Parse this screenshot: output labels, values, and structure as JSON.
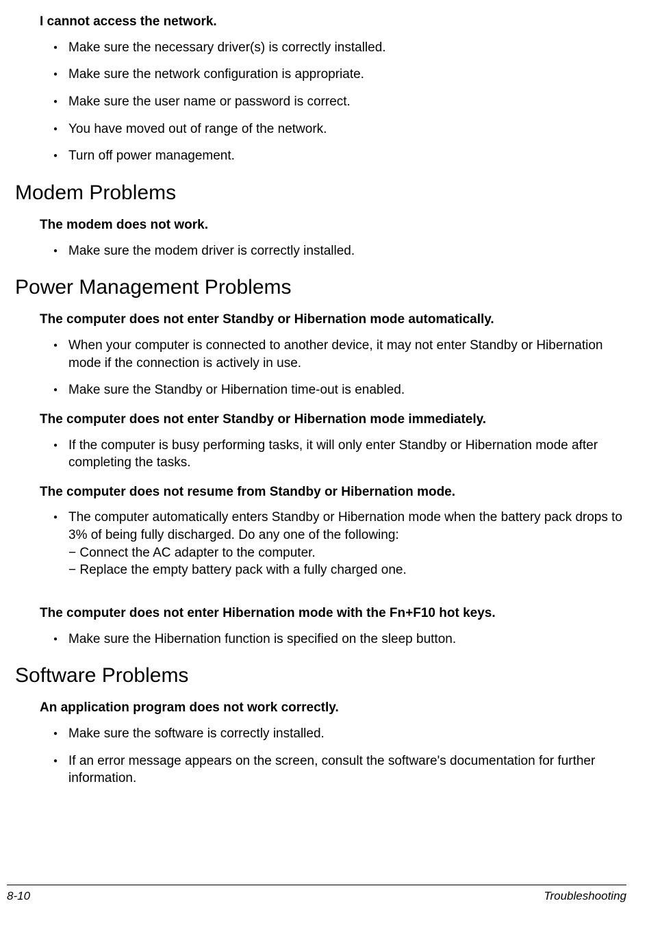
{
  "intro": {
    "title": "I cannot access the network.",
    "items": [
      "Make sure the necessary driver(s) is correctly installed.",
      "Make sure the network configuration is appropriate.",
      "Make sure the user name or password is correct.",
      "You have moved out of range of the network.",
      "Turn off power management."
    ]
  },
  "sections": [
    {
      "heading": "Modem Problems",
      "problems": [
        {
          "title": "The modem does not work.",
          "items": [
            {
              "text": "Make sure the modem driver is correctly installed."
            }
          ]
        }
      ]
    },
    {
      "heading": "Power Management Problems",
      "problems": [
        {
          "title": "The computer does not enter Standby or Hibernation mode automatically.",
          "items": [
            {
              "text": "When your computer is connected to another device, it may not enter Standby or Hibernation mode if the connection is actively in use."
            },
            {
              "text": "Make sure the Standby or Hibernation time-out is enabled."
            }
          ]
        },
        {
          "title": "The computer does not enter Standby or Hibernation mode immediately.",
          "items": [
            {
              "text": "If the computer is busy performing tasks, it will only enter Standby or Hibernation mode after completing the tasks."
            }
          ]
        },
        {
          "title": "The computer does not resume from Standby or Hibernation mode.",
          "items": [
            {
              "text": "The computer automatically enters Standby or Hibernation mode when the battery pack drops to 3% of being fully discharged. Do any one of the following:",
              "sub": [
                "− Connect the AC adapter to the computer.",
                "− Replace the empty battery pack with a fully charged one."
              ]
            }
          ]
        },
        {
          "title": "The computer does not enter Hibernation mode with the Fn+F10 hot keys.",
          "extraGap": true,
          "items": [
            {
              "text": "Make sure the Hibernation function is specified on the sleep button."
            }
          ]
        }
      ]
    },
    {
      "heading": "Software Problems",
      "problems": [
        {
          "title": "An application program does not work correctly.",
          "items": [
            {
              "text": "Make sure the software is correctly installed."
            },
            {
              "text": "If an error message appears on the screen, consult the software's documentation for further information."
            }
          ]
        }
      ]
    }
  ],
  "footer": {
    "left": "8-10",
    "right": "Troubleshooting"
  }
}
